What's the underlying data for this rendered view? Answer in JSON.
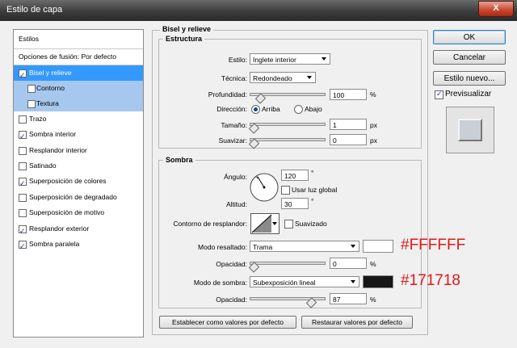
{
  "window": {
    "title": "Estilo de capa",
    "close_glyph": "X"
  },
  "left_list": {
    "header": "Estilos",
    "blend_options": "Opciones de fusión: Por defecto",
    "items": [
      {
        "label": "Bisel y relieve",
        "checked": true,
        "selected": true,
        "sub": false
      },
      {
        "label": "Contorno",
        "checked": false,
        "selected": false,
        "sub": true
      },
      {
        "label": "Textura",
        "checked": false,
        "selected": false,
        "sub": true
      },
      {
        "label": "Trazo",
        "checked": false,
        "selected": false,
        "sub": false
      },
      {
        "label": "Sombra interior",
        "checked": true,
        "selected": false,
        "sub": false
      },
      {
        "label": "Resplandor interior",
        "checked": false,
        "selected": false,
        "sub": false
      },
      {
        "label": "Satinado",
        "checked": false,
        "selected": false,
        "sub": false
      },
      {
        "label": "Superposición de colores",
        "checked": true,
        "selected": false,
        "sub": false
      },
      {
        "label": "Superposición de degradado",
        "checked": false,
        "selected": false,
        "sub": false
      },
      {
        "label": "Superposición de motivo",
        "checked": false,
        "selected": false,
        "sub": false
      },
      {
        "label": "Resplandor exterior",
        "checked": true,
        "selected": false,
        "sub": false
      },
      {
        "label": "Sombra paralela",
        "checked": true,
        "selected": false,
        "sub": false
      }
    ]
  },
  "bevel": {
    "title": "Bisel y relieve",
    "structure": {
      "title": "Estructura",
      "style_label": "Estilo:",
      "style_value": "Inglete interior",
      "technique_label": "Técnica:",
      "technique_value": "Redondeado",
      "depth_label": "Profundidad:",
      "depth_value": "100",
      "depth_unit": "%",
      "depth_level": 0.1,
      "direction_label": "Dirección:",
      "direction_up": "Arriba",
      "direction_down": "Abajo",
      "direction_selected": "up",
      "size_label": "Tamaño:",
      "size_value": "1",
      "size_unit": "px",
      "size_level": 0,
      "soften_label": "Suavizar:",
      "soften_value": "0",
      "soften_unit": "px",
      "soften_level": 0
    },
    "shading": {
      "title": "Sombra",
      "angle_label": "Ángulo:",
      "angle_value": "120",
      "angle_unit": "°",
      "global_light_label": "Usar luz global",
      "global_light_checked": false,
      "altitude_label": "Altitud:",
      "altitude_value": "30",
      "altitude_unit": "°",
      "gloss_label": "Contorno de resplandor:",
      "antialias_label": "Suavizado",
      "antialias_checked": false,
      "highlight_mode_label": "Modo resaltado:",
      "highlight_mode_value": "Trama",
      "highlight_color": "#FFFFFF",
      "highlight_hex_text": "#FFFFFF",
      "highlight_opacity_label": "Opacidad:",
      "highlight_opacity_value": "0",
      "highlight_opacity_unit": "%",
      "highlight_opacity_level": 0,
      "shadow_mode_label": "Modo de sombra:",
      "shadow_mode_value": "Subexposición lineal",
      "shadow_color": "#171718",
      "shadow_hex_text": "#171718",
      "shadow_opacity_label": "Opacidad:",
      "shadow_opacity_value": "87",
      "shadow_opacity_unit": "%",
      "shadow_opacity_level": 0.87
    },
    "make_default": "Establecer como valores por defecto",
    "reset_default": "Restaurar valores por defecto"
  },
  "right": {
    "ok": "OK",
    "cancel": "Cancelar",
    "new_style": "Estilo nuevo...",
    "preview_label": "Previsualizar",
    "preview_checked": true
  },
  "colors": {
    "selection": "#3399ff",
    "sub_selection": "#a6c8ee",
    "hex_annotation": "#e01818"
  }
}
